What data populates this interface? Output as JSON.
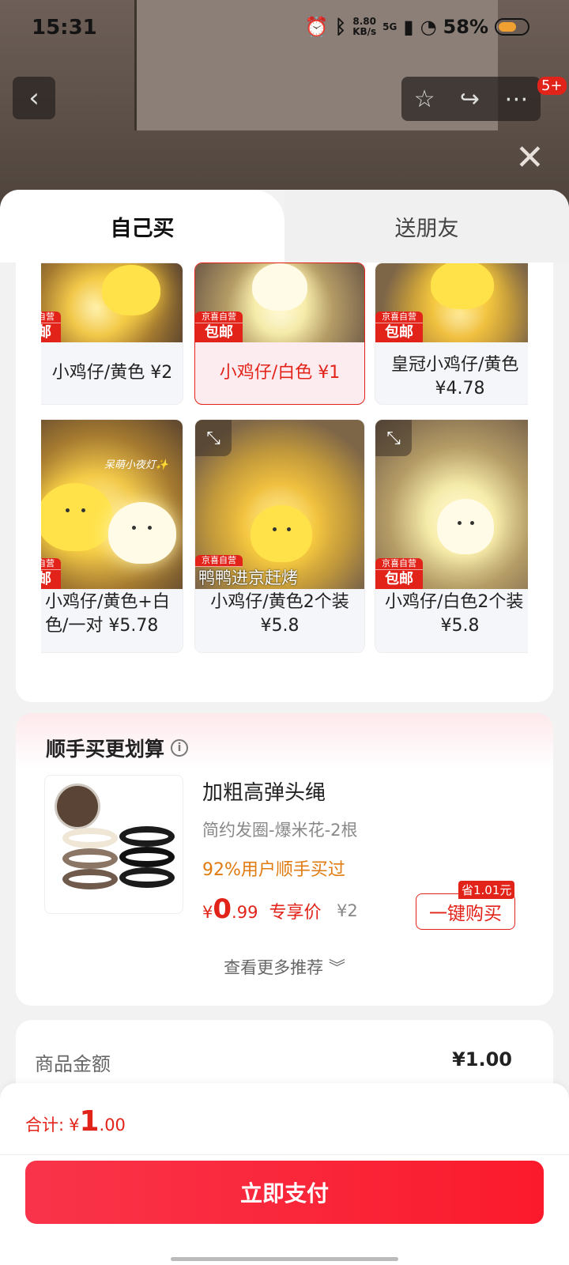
{
  "status": {
    "time": "15:31",
    "speed_top": "8.80",
    "speed_bottom": "KB/s",
    "network": "5G",
    "battery": "58%"
  },
  "nav": {
    "badge": "5+"
  },
  "tabs": {
    "self": "自己买",
    "friend": "送朋友"
  },
  "product_tags": {
    "line1": "京喜自营",
    "line2": "包邮"
  },
  "products": [
    {
      "label": "小鸡仔/黄色 ¥2"
    },
    {
      "label": "小鸡仔/白色 ¥1"
    },
    {
      "label1": "皇冠小鸡仔/黄色",
      "label2": "¥4.78"
    },
    {
      "label1": "小鸡仔/黄色+白",
      "label2": "色/一对 ¥5.78",
      "caption": "呆萌小夜灯✨"
    },
    {
      "label1": "小鸡仔/黄色2个装",
      "label2": "¥5.8",
      "caption": "鸭鸭进京赶烤"
    },
    {
      "label1": "小鸡仔/白色2个装",
      "label2": "¥5.8"
    }
  ],
  "bundle": {
    "title": "顺手买更划算",
    "name": "加粗高弹头绳",
    "spec": "简约发圈-爆米花-2根",
    "ratio": "92%用户顺手买过",
    "price_currency": "¥",
    "price_int": "0",
    "price_dec": ".99",
    "price_label": "专享价",
    "old_price": "¥2",
    "buy_label": "一键购买",
    "save_label": "省1.01元",
    "more_label": "查看更多推荐 ︾"
  },
  "summary": {
    "label": "商品金额",
    "value": "¥1.00"
  },
  "footer": {
    "total_label": "合计:",
    "currency": "¥",
    "int": "1",
    "dec": ".00",
    "pay_label": "立即支付"
  },
  "colors": {
    "accent": "#e2231a",
    "orange": "#e07b10"
  }
}
